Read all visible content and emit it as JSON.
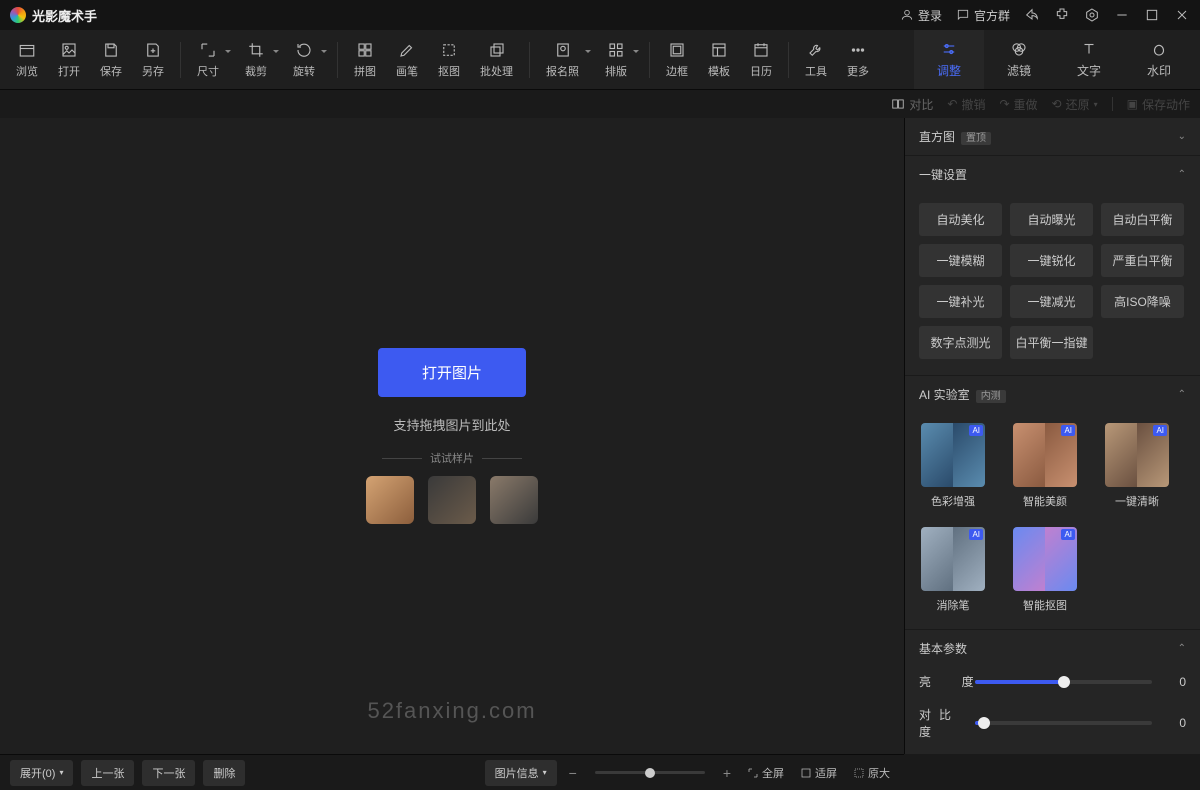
{
  "app": {
    "name": "光影魔术手"
  },
  "titlebar": {
    "login": "登录",
    "group": "官方群"
  },
  "toolbar": {
    "browse": "浏览",
    "open": "打开",
    "save": "保存",
    "saveas": "另存",
    "size": "尺寸",
    "crop": "裁剪",
    "rotate": "旋转",
    "puzzle": "拼图",
    "brush": "画笔",
    "cutout": "抠图",
    "batch": "批处理",
    "idphoto": "报名照",
    "layout": "排版",
    "border": "边框",
    "template": "模板",
    "calendar": "日历",
    "tools": "工具",
    "more": "更多"
  },
  "tabs": {
    "adjust": "调整",
    "filter": "滤镜",
    "text": "文字",
    "watermark": "水印"
  },
  "subbar": {
    "compare": "对比",
    "undo": "撤销",
    "redo": "重做",
    "restore": "还原",
    "saveaction": "保存动作"
  },
  "canvas": {
    "open_btn": "打开图片",
    "drag_hint": "支持拖拽图片到此处",
    "sample_hdr": "试试样片",
    "watermark": "52fanxing.com"
  },
  "sidebar": {
    "histogram": {
      "title": "直方图",
      "badge": "置顶"
    },
    "quickset": {
      "title": "一键设置",
      "btns": [
        "自动美化",
        "自动曝光",
        "自动白平衡",
        "一键模糊",
        "一键锐化",
        "严重白平衡",
        "一键补光",
        "一键减光",
        "高ISO降噪",
        "数字点测光",
        "白平衡一指键"
      ]
    },
    "ailab": {
      "title": "AI 实验室",
      "badge": "内测",
      "items": [
        "色彩增强",
        "智能美颜",
        "一键清晰",
        "消除笔",
        "智能抠图"
      ]
    },
    "basic": {
      "title": "基本参数",
      "brightness": {
        "label": "亮度",
        "value": 0,
        "pos": 50
      },
      "contrast": {
        "label": "对比度",
        "value": 0,
        "pos": 5
      }
    }
  },
  "bottombar": {
    "expand": "展开(0)",
    "prev": "上一张",
    "next": "下一张",
    "delete": "删除",
    "imginfo": "图片信息",
    "fullscreen": "全屏",
    "fit": "适屏",
    "original": "原大"
  }
}
